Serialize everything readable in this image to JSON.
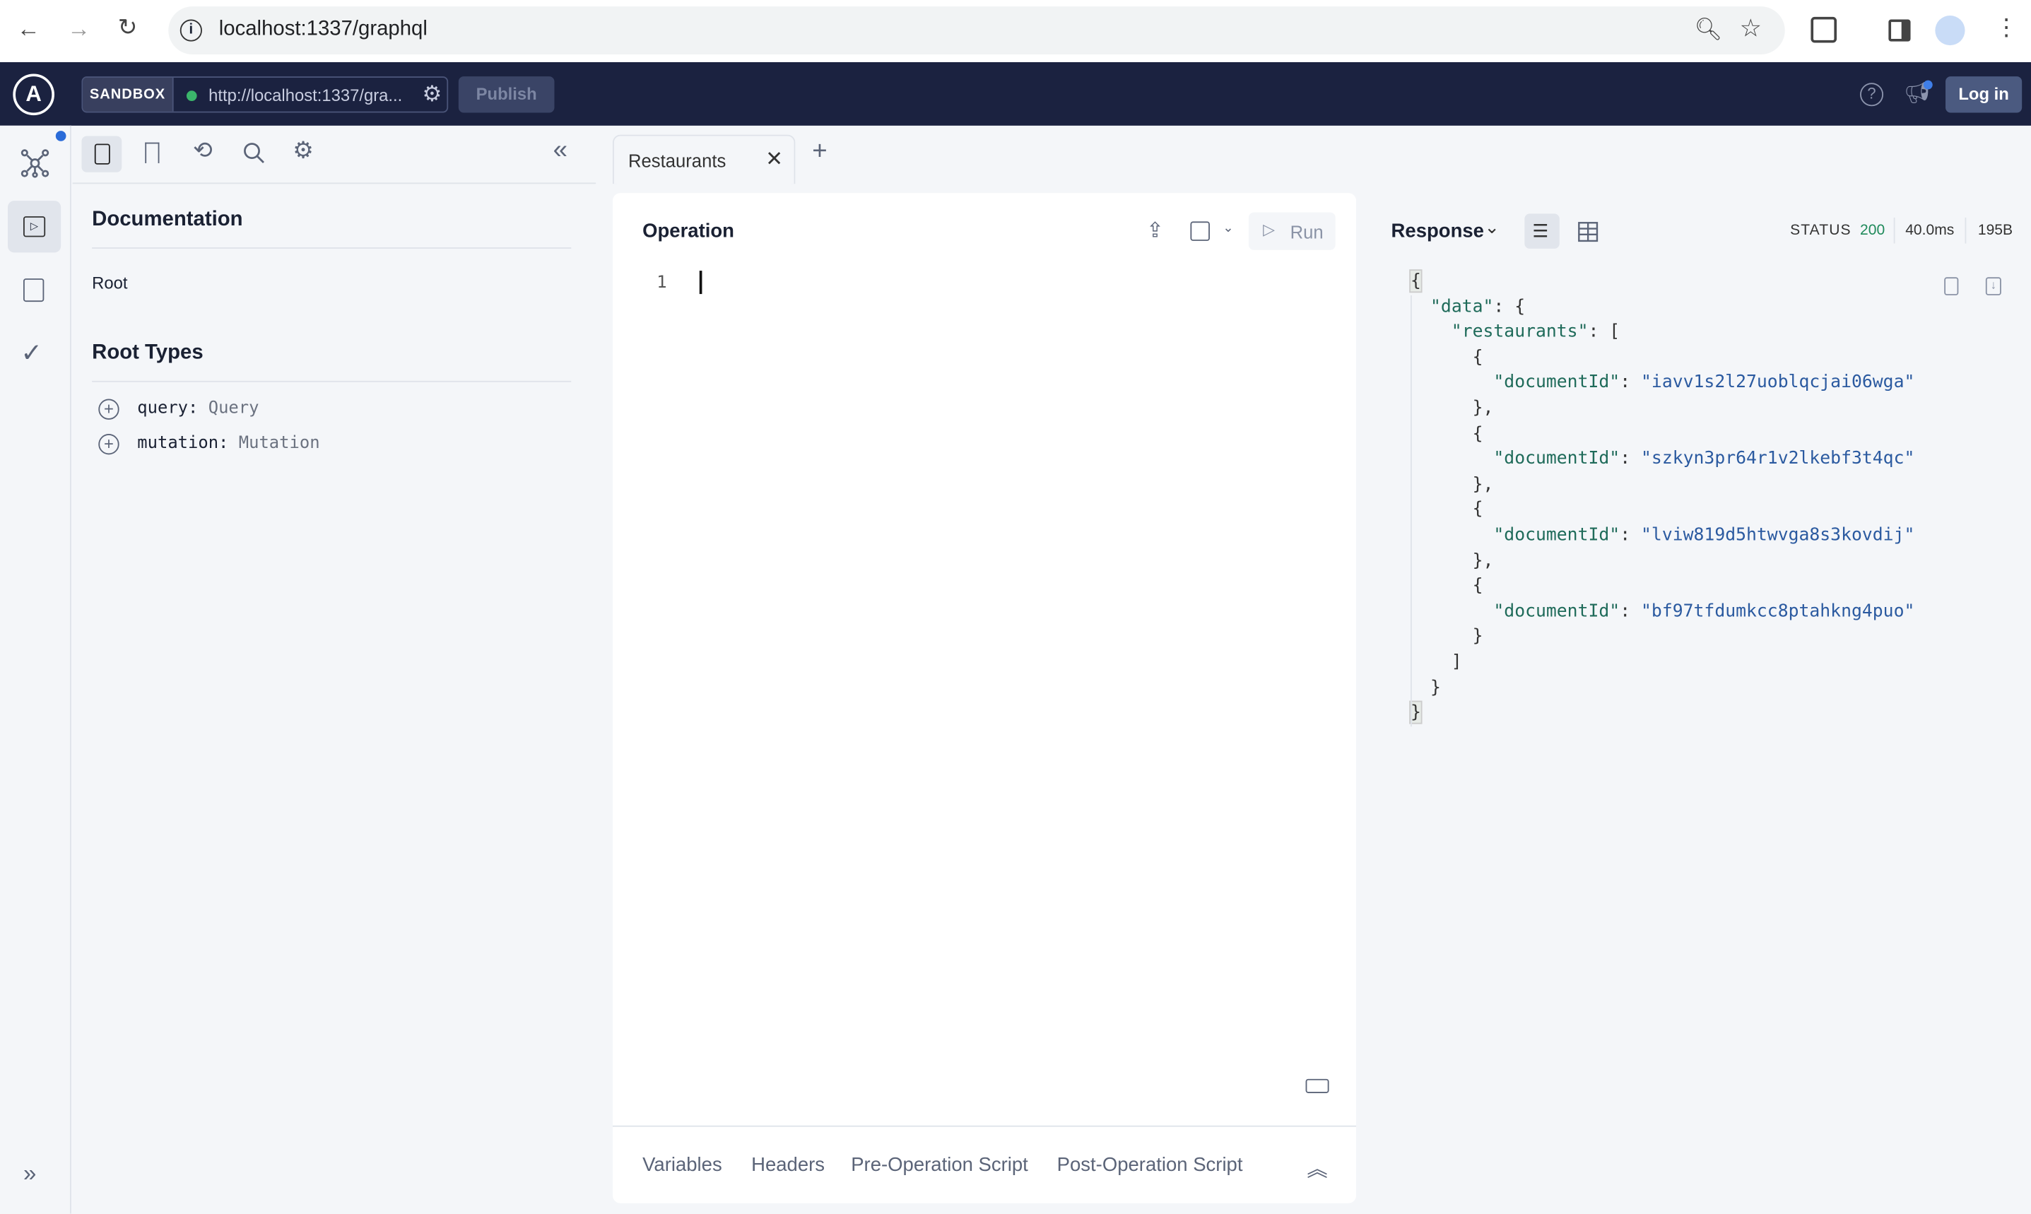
{
  "browser": {
    "url": "localhost:1337/graphql"
  },
  "header": {
    "sandbox_label": "SANDBOX",
    "endpoint": "http://localhost:1337/gra...",
    "publish_label": "Publish",
    "login_label": "Log in"
  },
  "docs": {
    "title": "Documentation",
    "breadcrumb": "Root",
    "root_types_title": "Root Types",
    "root_types": [
      {
        "field": "query:",
        "type": "Query"
      },
      {
        "field": "mutation:",
        "type": "Mutation"
      }
    ]
  },
  "tabs": [
    {
      "label": "Restaurants"
    }
  ],
  "operation": {
    "title": "Operation",
    "run_label": "Run",
    "line_number": "1",
    "bottom_tabs": [
      "Variables",
      "Headers",
      "Pre-Operation Script",
      "Post-Operation Script"
    ]
  },
  "response": {
    "title": "Response",
    "status_label": "STATUS",
    "status_code": "200",
    "time": "40.0ms",
    "size": "195B",
    "status_color": "#1f8a5b",
    "document_ids": [
      "iavv1s2l27uoblqcjai06wga",
      "szkyn3pr64r1v2lkebf3t4qc",
      "lviw819d5htwvga8s3kovdij",
      "bf97tfdumkcc8ptahkng4puo"
    ]
  },
  "json_tokens": {
    "data_key": "\"data\"",
    "restaurants_key": "\"restaurants\"",
    "doc_key": "\"documentId\""
  }
}
